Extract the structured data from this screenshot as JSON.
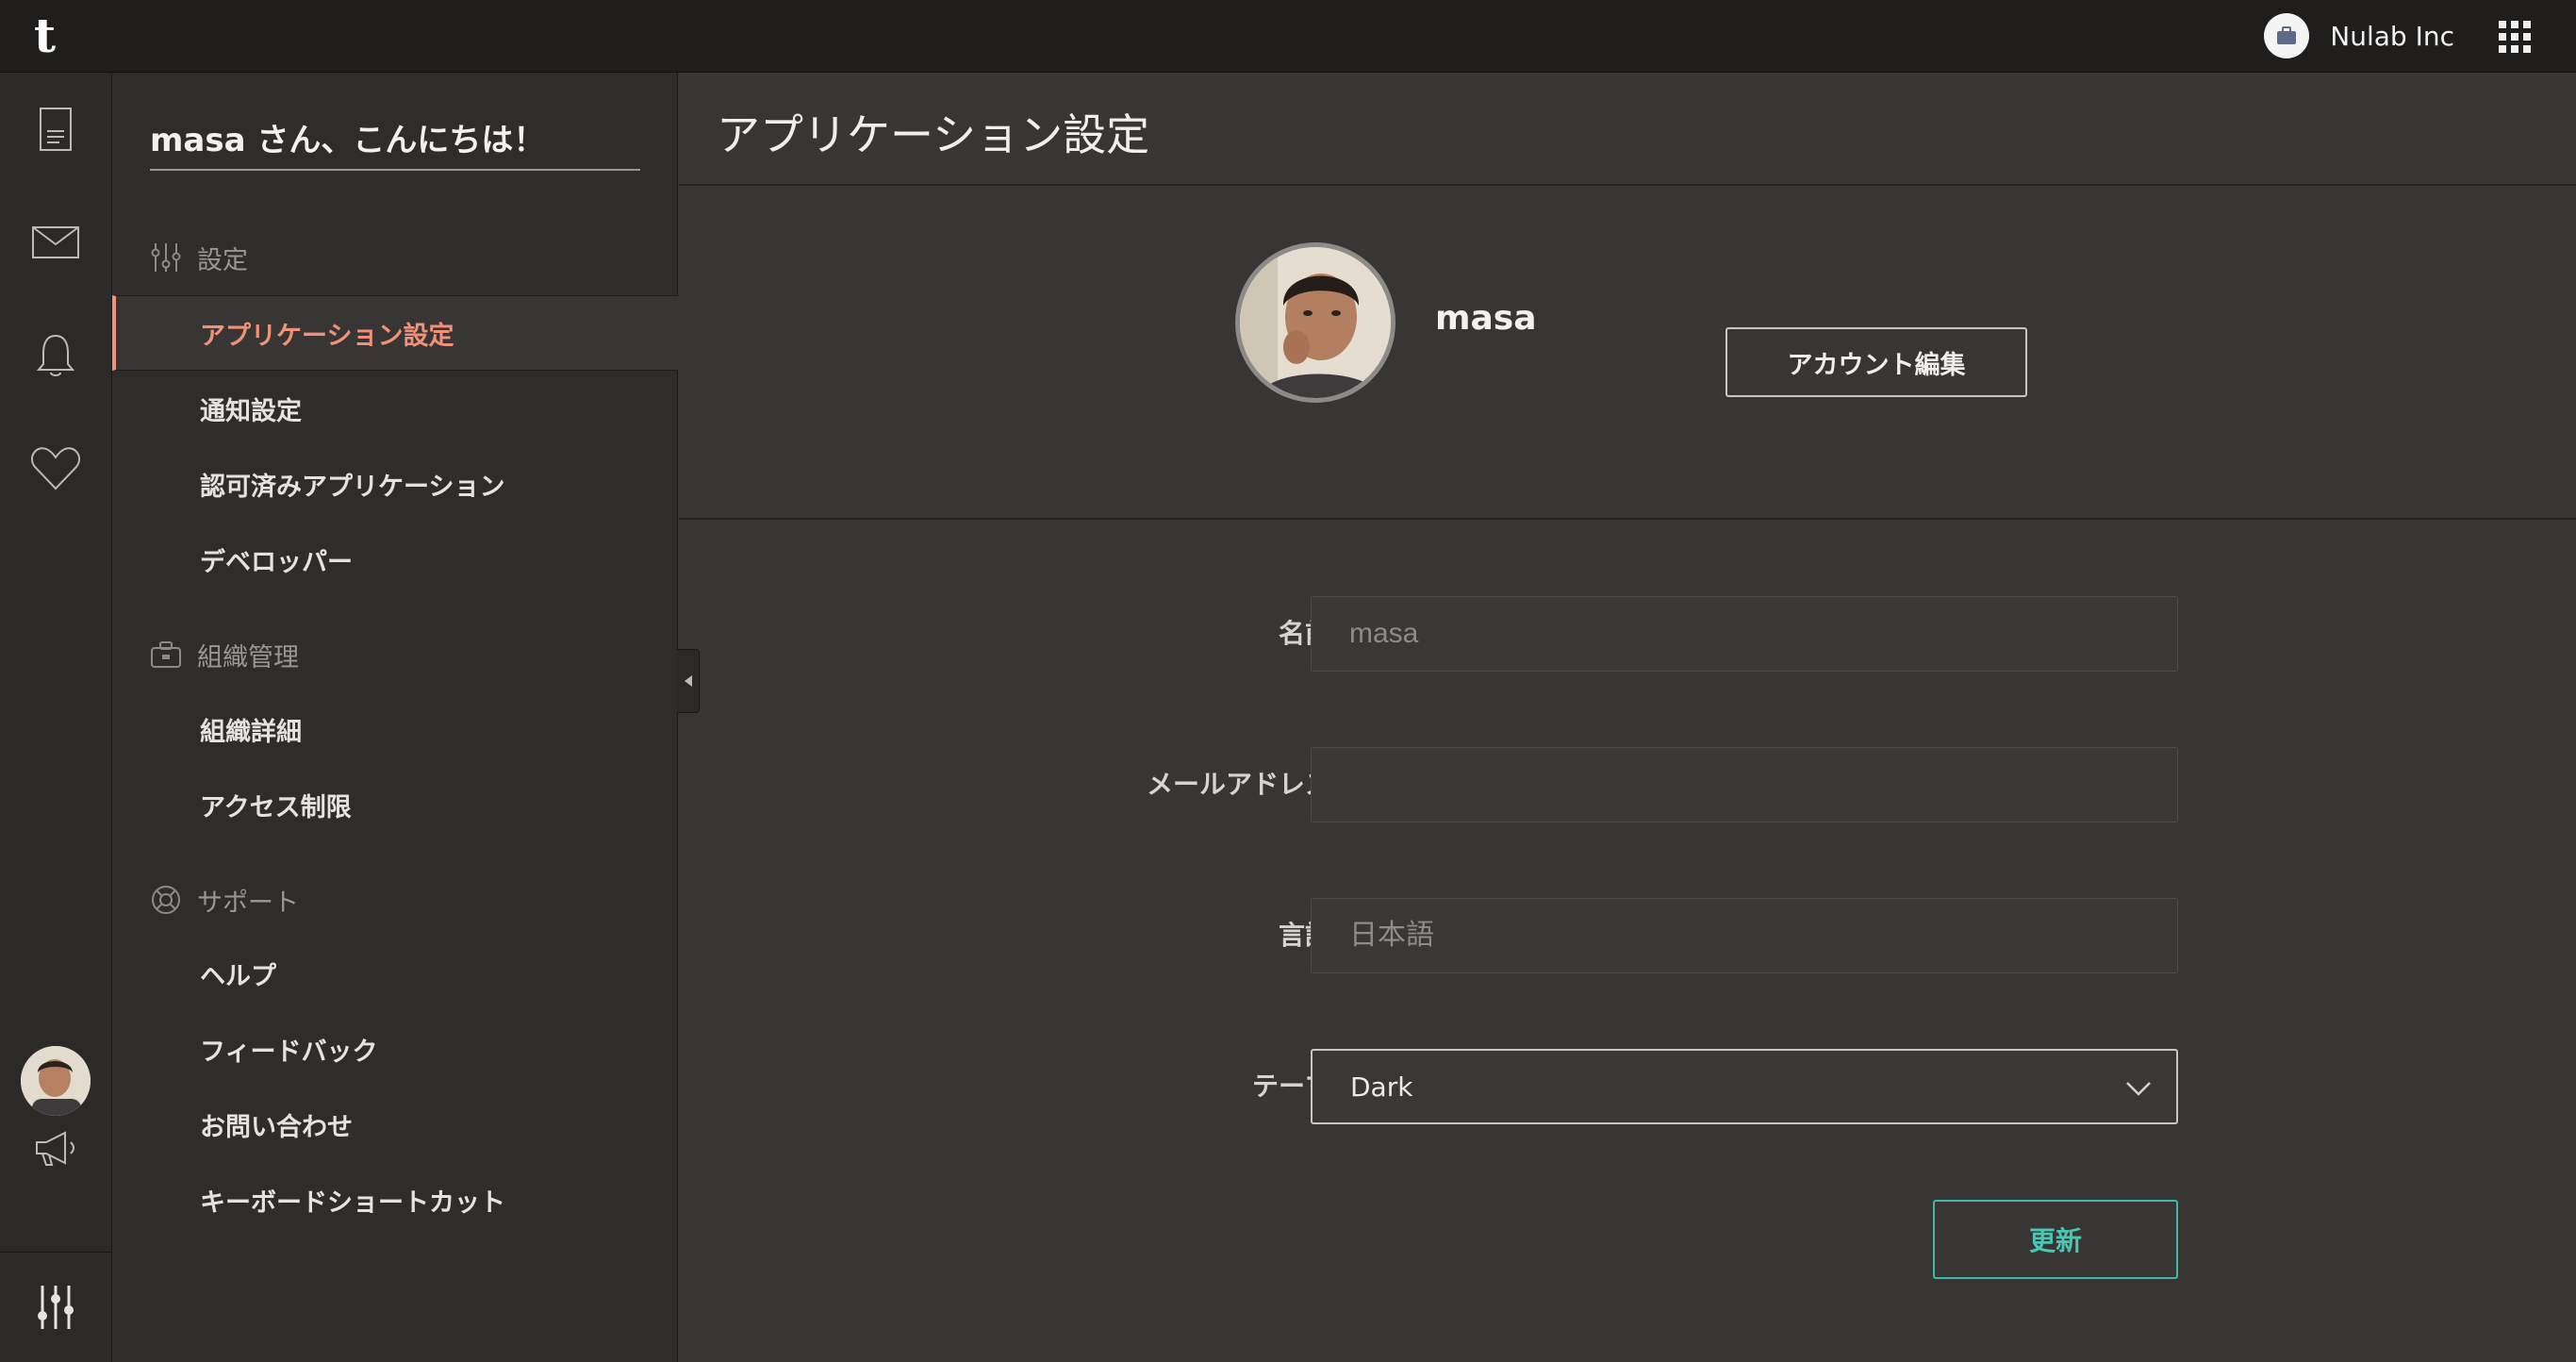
{
  "topbar": {
    "logo": "t",
    "org_name": "Nulab Inc",
    "org_icon": "briefcase-icon",
    "apps_icon": "grid-icon"
  },
  "rail": {
    "icons": [
      "document-icon",
      "mail-icon",
      "bell-icon",
      "heart-icon",
      "megaphone-icon",
      "sliders-icon"
    ]
  },
  "sidebar": {
    "greeting": "masa さん、こんにちは！",
    "sections": [
      {
        "title": "設定",
        "icon": "sliders-icon",
        "items": [
          "アプリケーション設定",
          "通知設定",
          "認可済みアプリケーション",
          "デベロッパー"
        ]
      },
      {
        "title": "組織管理",
        "icon": "briefcase-icon",
        "items": [
          "組織詳細",
          "アクセス制限"
        ]
      },
      {
        "title": "サポート",
        "icon": "lifebuoy-icon",
        "items": [
          "ヘルプ",
          "フィードバック",
          "お問い合わせ",
          "キーボードショートカット"
        ]
      }
    ],
    "active_item": "アプリケーション設定"
  },
  "main": {
    "title": "アプリケーション設定",
    "profile": {
      "name": "masa",
      "edit_label": "アカウント編集"
    },
    "form": {
      "name_label": "名前",
      "name_value": "masa",
      "email_label": "メールアドレス",
      "email_value": "",
      "language_label": "言語",
      "language_value": "日本語",
      "theme_label": "テーマ",
      "theme_value": "Dark",
      "submit_label": "更新"
    }
  },
  "colors": {
    "accent": "#f2917a",
    "submit": "#49c7b5",
    "background": "#383634",
    "sidebar": "#2f2d2c",
    "topbar": "#1f1e1d"
  }
}
